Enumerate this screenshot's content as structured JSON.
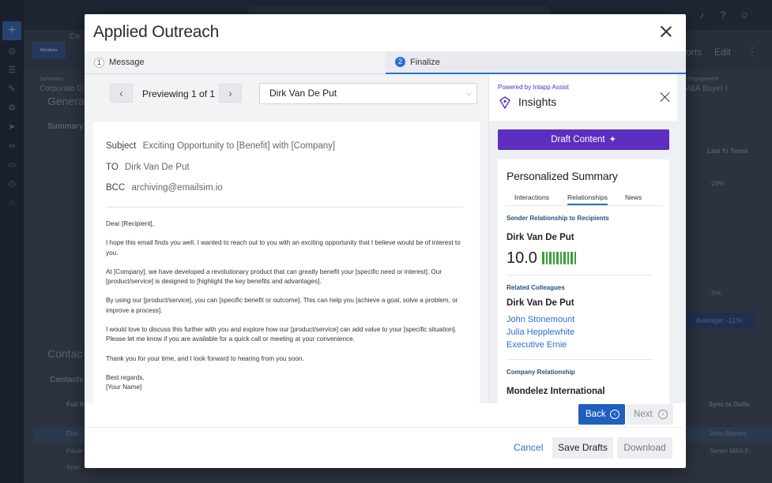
{
  "background": {
    "breadcrumb_fragment": "Co",
    "summary_label": "Summary",
    "corporate_label": "Corporate O",
    "general_label": "Genera",
    "summary_tab": "Summary",
    "top_actions": [
      "orts",
      "Edit",
      "⋮"
    ],
    "engagement_label": "Engagement",
    "engagement_value": "M&A Buyer I",
    "last_yr_trend": "Last Yr Trend",
    "trend_values": [
      "-29%",
      "-5%"
    ],
    "average_label": "Average: -11%",
    "contacts_title": "Contac",
    "contacts_tab": "Contacts",
    "full_name_header": "Full N",
    "sync_header": "Sync to Outlo",
    "row_values": [
      "Dirk",
      "Paule",
      "Andr",
      "John Stonem",
      "Senior M&A E"
    ]
  },
  "modal": {
    "title": "Applied Outreach",
    "steps": [
      {
        "num": "1",
        "label": "Message"
      },
      {
        "num": "2",
        "label": "Finalize"
      }
    ],
    "preview": {
      "prev_icon": "chevron-left-icon",
      "next_icon": "chevron-right-icon",
      "label": "Previewing 1 of 1",
      "recipient": "Dirk Van De Put"
    },
    "email": {
      "subject_key": "Subject",
      "subject_value": "Exciting Opportunity to [Benefit] with [Company]",
      "to_key": "TO",
      "to_value": "Dirk Van De Put",
      "bcc_key": "BCC",
      "bcc_value": "archiving@emailsim.io",
      "greeting": "Dear [Recipient],",
      "paragraphs": [
        "I hope this email finds you well. I wanted to reach out to you with an exciting opportunity that I believe would be of interest to you.",
        "At [Company], we have developed a revolutionary product that can greatly benefit your [specific need or interest]. Our [product/service] is designed to [highlight the key benefits and advantages].",
        "By using our [product/service], you can [specific benefit or outcome]. This can help you [achieve a goal, solve a problem, or improve a process].",
        "I would love to discuss this further with you and explore how our [product/service] can add value to your [specific situation]. Please let me know if you are available for a quick call or meeting at your convenience.",
        "Thank you for your time, and I look forward to hearing from you soon."
      ],
      "signoff": "Best regards,",
      "signature": "[Your Name]"
    },
    "insights": {
      "powered_by": "Powered by Intapp Assist",
      "title": "Insights",
      "draft_button": "Draft Content",
      "summary_title": "Personalized Summary",
      "tabs": [
        "Interactions",
        "Relationships",
        "News"
      ],
      "active_tab": "Relationships",
      "sender_section": "Sender Relationship to Recipients",
      "recipient_name": "Dirk Van De Put",
      "score": "10.0",
      "related_section": "Related Colleagues",
      "related_person": "Dirk Van De Put",
      "colleagues": [
        "John Stonemount",
        "Julia Hepplewhite",
        "Executive Ernie"
      ],
      "company_section": "Company Relationship",
      "company_name": "Mondelez International"
    },
    "nav": {
      "back": "Back",
      "next": "Next"
    },
    "footer": {
      "cancel": "Cancel",
      "save": "Save Drafts",
      "download": "Download"
    }
  },
  "colors": {
    "accent_blue": "#2a6fd4",
    "purple": "#5c2fc0",
    "score_green": "#3aa13a"
  }
}
